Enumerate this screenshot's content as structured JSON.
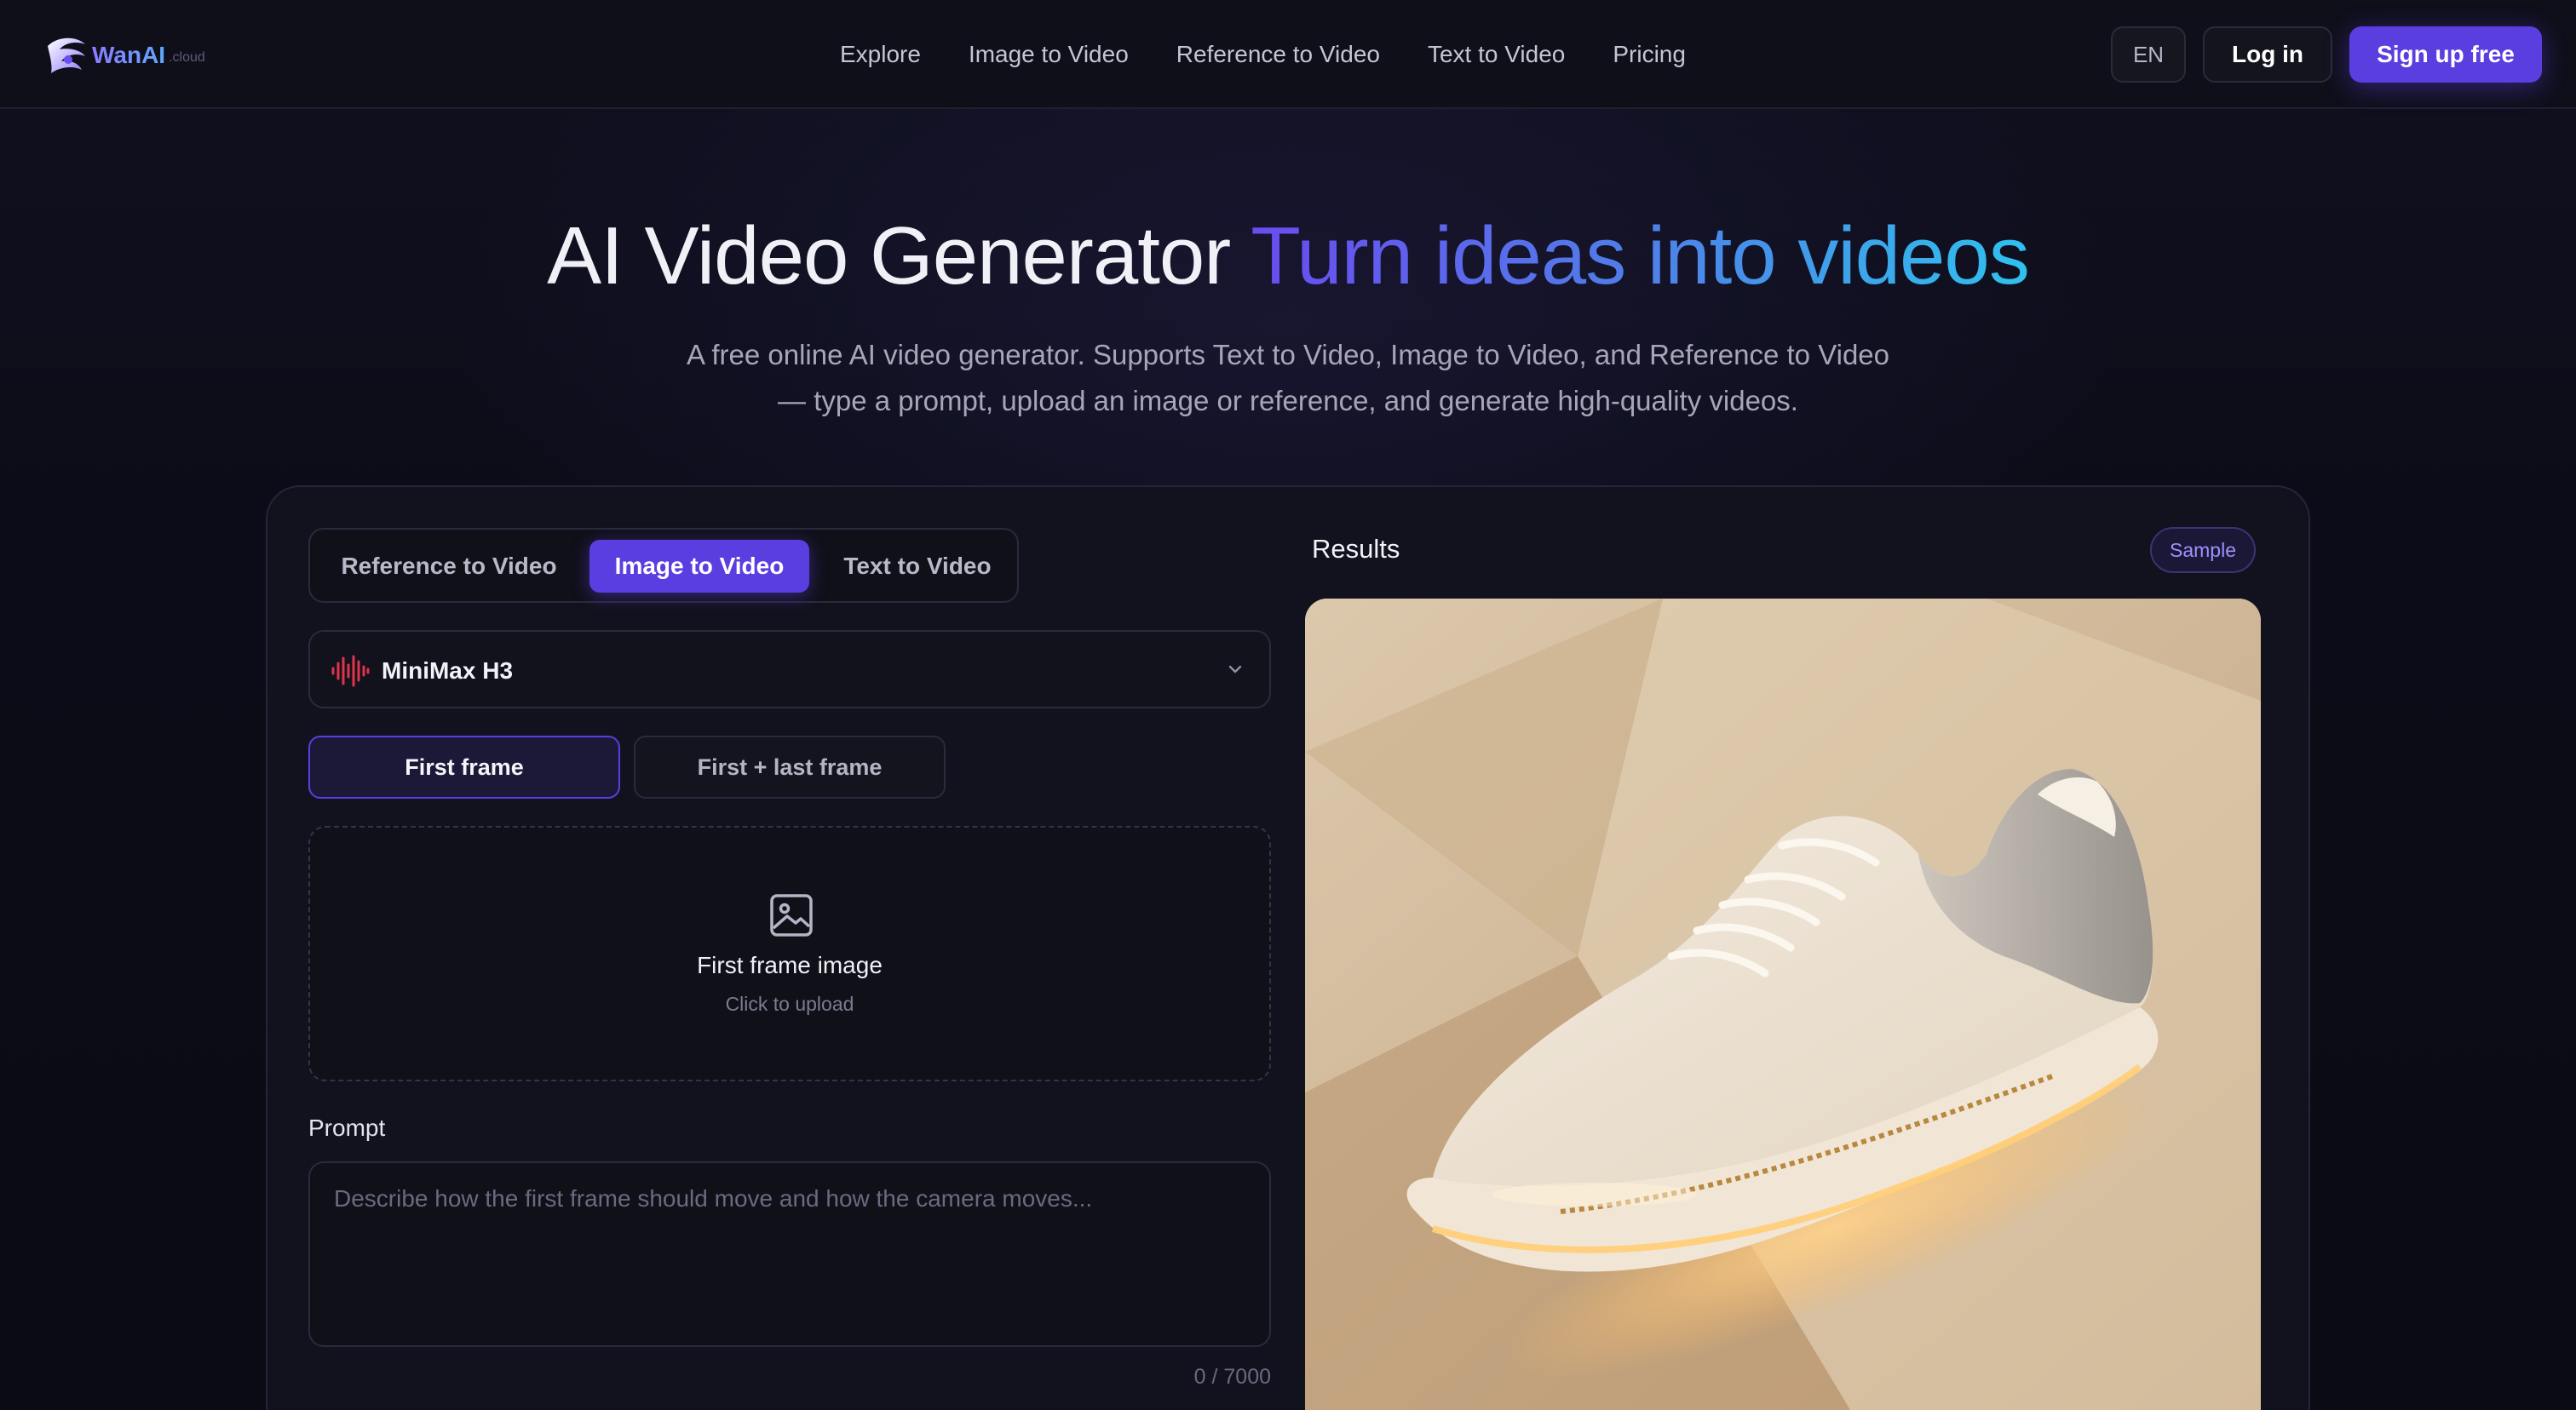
{
  "brand": {
    "name": "WanAI",
    "suffix": ".cloud"
  },
  "nav": {
    "links": [
      "Explore",
      "Image to Video",
      "Reference to Video",
      "Text to Video",
      "Pricing"
    ],
    "lang": "EN",
    "login": "Log in",
    "signup": "Sign up free"
  },
  "hero": {
    "title_plain": "AI Video Generator",
    "title_gradient": "Turn ideas into videos",
    "subtitle_line1": "A free online AI video generator. Supports Text to Video, Image to Video, and Reference to Video",
    "subtitle_line2": "— type a prompt, upload an image or reference, and generate high-quality videos."
  },
  "generator": {
    "tabs": [
      "Reference to Video",
      "Image to Video",
      "Text to Video"
    ],
    "active_tab": "Image to Video",
    "model": "MiniMax H3",
    "frame_modes": [
      "First frame",
      "First + last frame"
    ],
    "active_frame_mode": "First frame",
    "upload": {
      "title": "First frame image",
      "hint": "Click to upload"
    },
    "prompt": {
      "label": "Prompt",
      "placeholder": "Describe how the first frame should move and how the camera moves...",
      "value": "",
      "counter": "0 / 7000"
    }
  },
  "results": {
    "label": "Results",
    "badge": "Sample",
    "preview": "sneaker-sample-image"
  },
  "colors": {
    "accent": "#5b3ee0",
    "background": "#0b0b14",
    "card": "#12121e",
    "gradient_start": "#6a4cf0",
    "gradient_end": "#2fc1ee",
    "model_icon": "#e0344c"
  }
}
